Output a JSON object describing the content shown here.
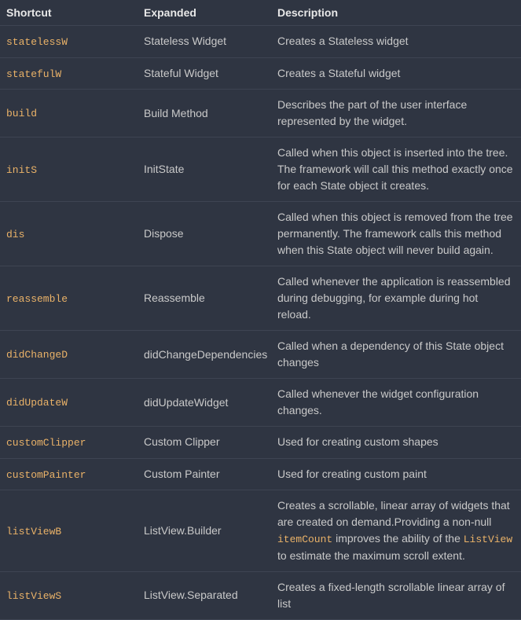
{
  "headers": {
    "shortcut": "Shortcut",
    "expanded": "Expanded",
    "description": "Description"
  },
  "rows": [
    {
      "shortcut": "statelessW",
      "expanded": "Stateless Widget",
      "description": "Creates a Stateless widget"
    },
    {
      "shortcut": "statefulW",
      "expanded": "Stateful Widget",
      "description": "Creates a Stateful widget"
    },
    {
      "shortcut": "build",
      "expanded": "Build Method",
      "description": "Describes the part of the user interface represented by the widget."
    },
    {
      "shortcut": "initS",
      "expanded": "InitState",
      "description": "Called when this object is inserted into the tree. The framework will call this method exactly once for each State object it creates."
    },
    {
      "shortcut": "dis",
      "expanded": "Dispose",
      "description": "Called when this object is removed from the tree permanently. The framework calls this method when this State object will never build again."
    },
    {
      "shortcut": "reassemble",
      "expanded": "Reassemble",
      "description": "Called whenever the application is reassembled during debugging, for example during hot reload."
    },
    {
      "shortcut": "didChangeD",
      "expanded": "didChangeDependencies",
      "description": "Called when a dependency of this State object changes"
    },
    {
      "shortcut": "didUpdateW",
      "expanded": "didUpdateWidget",
      "description": "Called whenever the widget configuration changes."
    },
    {
      "shortcut": "customClipper",
      "expanded": "Custom Clipper",
      "description": "Used for creating custom shapes"
    },
    {
      "shortcut": "customPainter",
      "expanded": "Custom Painter",
      "description": "Used for creating custom paint"
    },
    {
      "shortcut": "listViewB",
      "expanded": "ListView.Builder",
      "description_parts": [
        "Creates a scrollable, linear array of widgets that are created on demand.Providing a non-null ",
        "itemCount",
        " improves the ability of the ",
        "ListView",
        " to estimate the maximum scroll extent."
      ]
    },
    {
      "shortcut": "listViewS",
      "expanded": "ListView.Separated",
      "description": "Creates a fixed-length scrollable linear array of list"
    }
  ]
}
